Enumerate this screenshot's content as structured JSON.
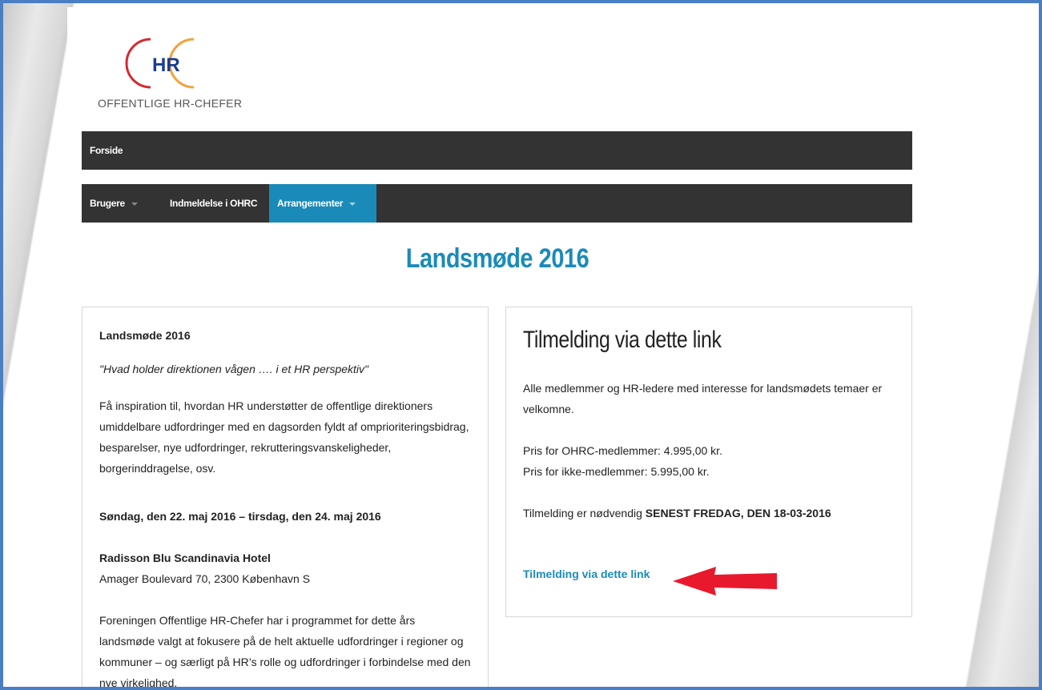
{
  "logo": {
    "mark": "HR",
    "text": "OFFENTLIGE HR-CHEFER",
    "colors": {
      "red": "#d7282f",
      "blue": "#1b3c8f",
      "orange": "#f2a23a"
    }
  },
  "nav_top": {
    "items": [
      {
        "label": "Forside"
      }
    ]
  },
  "nav_main": {
    "items": [
      {
        "label": "Brugere",
        "has_dropdown": true,
        "active": false
      },
      {
        "label": "Indmeldelse i OHRC",
        "has_dropdown": false,
        "active": false
      },
      {
        "label": "Arrangementer",
        "has_dropdown": true,
        "active": true
      }
    ]
  },
  "page_title": "Landsmøde 2016",
  "left_panel": {
    "heading": "Landsmøde 2016",
    "quote": "\"Hvad holder direktionen vågen …. i et HR perspektiv\"",
    "intro": "Få inspiration til, hvordan HR understøtter de offentlige direktioners umiddelbare udfordringer med en dagsorden fyldt af omprioriteringsbidrag, besparelser, nye udfordringer, rekrutteringsvanskeligheder, borgerinddragelse, osv.",
    "dates": "Søndag, den 22. maj 2016 – tirsdag, den 24. maj 2016",
    "venue_name": "Radisson Blu Scandinavia Hotel",
    "venue_address": "Amager Boulevard 70, 2300 København S",
    "body": "Foreningen Offentlige HR-Chefer har i programmet for dette års landsmøde valgt at fokusere på de helt aktuelle udfordringer i regioner og kommuner – og særligt på HR’s rolle og udfordringer i forbindelse med den nye virkelighed."
  },
  "right_panel": {
    "heading": "Tilmelding via dette link",
    "welcome": "Alle medlemmer og HR-ledere med interesse for landsmødets temaer er velkomne.",
    "price_members": "Pris for OHRC-medlemmer: 4.995,00 kr.",
    "price_nonmembers": "Pris for ikke-medlemmer: 5.995,00 kr.",
    "deadline_prefix": "Tilmelding er nødvendig ",
    "deadline_bold": "SENEST FREDAG, DEN 18-03-2016",
    "link_label": "Tilmelding via dette link"
  },
  "colors": {
    "accent": "#1a8bb9",
    "navbar": "#333333",
    "frame": "#4a7fc3",
    "arrow": "#e8192c"
  }
}
